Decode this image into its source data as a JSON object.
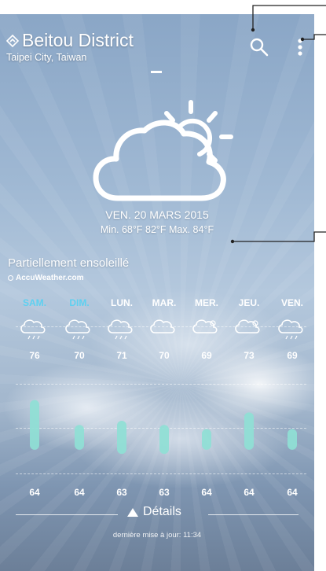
{
  "location": {
    "name": "Beitou District",
    "region": "Taipei City, Taiwan"
  },
  "current": {
    "date": "VEN. 20 MARS 2015",
    "minmax": "Min. 68°F 82°F Max. 84°F",
    "condition": "Partiellement ensoleillé",
    "condition_icon": "partly-sunny-icon"
  },
  "brand": "AccuWeather.com",
  "colors": {
    "bar_fill": "#8fe0d5",
    "day_highlight": "#5ed0f0",
    "text": "#ffffff"
  },
  "chart_data": {
    "type": "bar",
    "categories": [
      "SAM.",
      "DIM.",
      "LUN.",
      "MAR.",
      "MER.",
      "JEU.",
      "VEN."
    ],
    "highlighted": [
      true,
      true,
      false,
      false,
      false,
      false,
      false
    ],
    "icons": [
      "showers-icon",
      "showers-icon",
      "showers-icon",
      "cloudy-icon",
      "partly-sunny-icon",
      "partly-sunny-icon",
      "showers-icon"
    ],
    "series": [
      {
        "name": "high",
        "values": [
          76,
          70,
          71,
          70,
          69,
          73,
          69
        ]
      },
      {
        "name": "low",
        "values": [
          64,
          64,
          63,
          63,
          64,
          64,
          64
        ]
      }
    ],
    "ylim": [
      60,
      78
    ]
  },
  "footer": {
    "details_label": "Détails",
    "updated": "dernière mise à jour: 11:34"
  }
}
